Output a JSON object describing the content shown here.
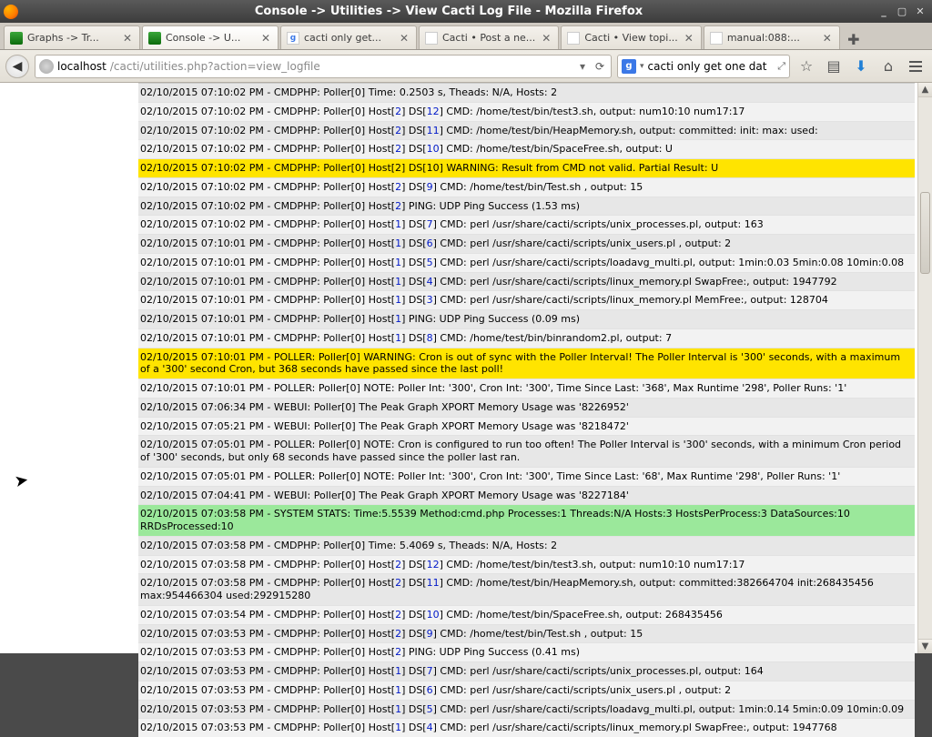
{
  "window": {
    "title": "Console -> Utilities -> View Cacti Log File - Mozilla Firefox"
  },
  "tabs": [
    {
      "label": "Graphs -> Tr...",
      "kind": "cacti"
    },
    {
      "label": "Console -> U...",
      "kind": "cacti",
      "active": true
    },
    {
      "label": "cacti only get...",
      "kind": "google"
    },
    {
      "label": "Cacti • Post a ne...",
      "kind": "plain"
    },
    {
      "label": "Cacti • View topi...",
      "kind": "plain"
    },
    {
      "label": "manual:088:...",
      "kind": "doc"
    }
  ],
  "url": {
    "host": "localhost",
    "path": "/cacti/utilities.php?action=view_logfile"
  },
  "search": {
    "value": "cacti only get one dat"
  },
  "log": [
    {
      "cls": "g2 trim",
      "segs": [
        {
          "t": "02/10/2015 07:10:02 PM - CMDPHP: Poller[0] Time: 0.2503 s, Theads: N/A, Hosts: 2"
        }
      ]
    },
    {
      "cls": "g1",
      "segs": [
        {
          "t": "02/10/2015 07:10:02 PM - CMDPHP: Poller[0] Host["
        },
        {
          "t": "2",
          "b": 1
        },
        {
          "t": "] DS["
        },
        {
          "t": "12",
          "b": 1
        },
        {
          "t": "] CMD: /home/test/bin/test3.sh, output: num10:10 num17:17"
        }
      ]
    },
    {
      "cls": "g2",
      "segs": [
        {
          "t": "02/10/2015 07:10:02 PM - CMDPHP: Poller[0] Host["
        },
        {
          "t": "2",
          "b": 1
        },
        {
          "t": "] DS["
        },
        {
          "t": "11",
          "b": 1
        },
        {
          "t": "] CMD: /home/test/bin/HeapMemory.sh, output: committed: init: max: used:"
        }
      ]
    },
    {
      "cls": "g1",
      "segs": [
        {
          "t": "02/10/2015 07:10:02 PM - CMDPHP: Poller[0] Host["
        },
        {
          "t": "2",
          "b": 1
        },
        {
          "t": "] DS["
        },
        {
          "t": "10",
          "b": 1
        },
        {
          "t": "] CMD: /home/test/bin/SpaceFree.sh, output: U"
        }
      ]
    },
    {
      "cls": "warn",
      "segs": [
        {
          "t": "02/10/2015 07:10:02 PM - CMDPHP: Poller[0] Host[2] DS[10] WARNING: Result from CMD not valid. Partial Result: U"
        }
      ]
    },
    {
      "cls": "g1",
      "segs": [
        {
          "t": "02/10/2015 07:10:02 PM - CMDPHP: Poller[0] Host["
        },
        {
          "t": "2",
          "b": 1
        },
        {
          "t": "] DS["
        },
        {
          "t": "9",
          "b": 1
        },
        {
          "t": "] CMD: /home/test/bin/Test.sh , output: 15"
        }
      ]
    },
    {
      "cls": "g2",
      "segs": [
        {
          "t": "02/10/2015 07:10:02 PM - CMDPHP: Poller[0] Host["
        },
        {
          "t": "2",
          "b": 1
        },
        {
          "t": "] PING: UDP Ping Success (1.53 ms)"
        }
      ]
    },
    {
      "cls": "g1",
      "segs": [
        {
          "t": "02/10/2015 07:10:02 PM - CMDPHP: Poller[0] Host["
        },
        {
          "t": "1",
          "b": 1
        },
        {
          "t": "] DS["
        },
        {
          "t": "7",
          "b": 1
        },
        {
          "t": "] CMD: perl /usr/share/cacti/scripts/unix_processes.pl, output: 163"
        }
      ]
    },
    {
      "cls": "g2",
      "segs": [
        {
          "t": "02/10/2015 07:10:01 PM - CMDPHP: Poller[0] Host["
        },
        {
          "t": "1",
          "b": 1
        },
        {
          "t": "] DS["
        },
        {
          "t": "6",
          "b": 1
        },
        {
          "t": "] CMD: perl /usr/share/cacti/scripts/unix_users.pl , output: 2"
        }
      ]
    },
    {
      "cls": "g1",
      "segs": [
        {
          "t": "02/10/2015 07:10:01 PM - CMDPHP: Poller[0] Host["
        },
        {
          "t": "1",
          "b": 1
        },
        {
          "t": "] DS["
        },
        {
          "t": "5",
          "b": 1
        },
        {
          "t": "] CMD: perl /usr/share/cacti/scripts/loadavg_multi.pl, output: 1min:0.03 5min:0.08 10min:0.08"
        }
      ]
    },
    {
      "cls": "g2",
      "segs": [
        {
          "t": "02/10/2015 07:10:01 PM - CMDPHP: Poller[0] Host["
        },
        {
          "t": "1",
          "b": 1
        },
        {
          "t": "] DS["
        },
        {
          "t": "4",
          "b": 1
        },
        {
          "t": "] CMD: perl /usr/share/cacti/scripts/linux_memory.pl SwapFree:, output: 1947792"
        }
      ]
    },
    {
      "cls": "g1",
      "segs": [
        {
          "t": "02/10/2015 07:10:01 PM - CMDPHP: Poller[0] Host["
        },
        {
          "t": "1",
          "b": 1
        },
        {
          "t": "] DS["
        },
        {
          "t": "3",
          "b": 1
        },
        {
          "t": "] CMD: perl /usr/share/cacti/scripts/linux_memory.pl MemFree:, output: 128704"
        }
      ]
    },
    {
      "cls": "g2",
      "segs": [
        {
          "t": "02/10/2015 07:10:01 PM - CMDPHP: Poller[0] Host["
        },
        {
          "t": "1",
          "b": 1
        },
        {
          "t": "] PING: UDP Ping Success (0.09 ms)"
        }
      ]
    },
    {
      "cls": "g1",
      "segs": [
        {
          "t": "02/10/2015 07:10:01 PM - CMDPHP: Poller[0] Host["
        },
        {
          "t": "1",
          "b": 1
        },
        {
          "t": "] DS["
        },
        {
          "t": "8",
          "b": 1
        },
        {
          "t": "] CMD: /home/test/bin/binrandom2.pl, output: 7"
        }
      ]
    },
    {
      "cls": "warn",
      "segs": [
        {
          "t": "02/10/2015 07:10:01 PM - POLLER: Poller[0] WARNING: Cron is out of sync with the Poller Interval! The Poller Interval is '300' seconds, with a maximum of a '300' second Cron, but 368 seconds have passed since the last poll!"
        }
      ]
    },
    {
      "cls": "g1",
      "segs": [
        {
          "t": "02/10/2015 07:10:01 PM - POLLER: Poller[0] NOTE: Poller Int: '300', Cron Int: '300', Time Since Last: '368', Max Runtime '298', Poller Runs: '1'"
        }
      ]
    },
    {
      "cls": "g2",
      "segs": [
        {
          "t": "02/10/2015 07:06:34 PM - WEBUI: Poller[0] The Peak Graph XPORT Memory Usage was '8226952'"
        }
      ]
    },
    {
      "cls": "g1",
      "segs": [
        {
          "t": "02/10/2015 07:05:21 PM - WEBUI: Poller[0] The Peak Graph XPORT Memory Usage was '8218472'"
        }
      ]
    },
    {
      "cls": "g2",
      "segs": [
        {
          "t": "02/10/2015 07:05:01 PM - POLLER: Poller[0] NOTE: Cron is configured to run too often! The Poller Interval is '300' seconds, with a minimum Cron period of '300' seconds, but only 68 seconds have passed since the poller last ran."
        }
      ]
    },
    {
      "cls": "g1",
      "segs": [
        {
          "t": "02/10/2015 07:05:01 PM - POLLER: Poller[0] NOTE: Poller Int: '300', Cron Int: '300', Time Since Last: '68', Max Runtime '298', Poller Runs: '1'"
        }
      ]
    },
    {
      "cls": "g2",
      "segs": [
        {
          "t": "02/10/2015 07:04:41 PM - WEBUI: Poller[0] The Peak Graph XPORT Memory Usage was '8227184'"
        }
      ]
    },
    {
      "cls": "ok",
      "segs": [
        {
          "t": "02/10/2015 07:03:58 PM - SYSTEM STATS: Time:5.5539 Method:cmd.php Processes:1 Threads:N/A Hosts:3 HostsPerProcess:3 DataSources:10 RRDsProcessed:10"
        }
      ]
    },
    {
      "cls": "g2",
      "segs": [
        {
          "t": "02/10/2015 07:03:58 PM - CMDPHP: Poller[0] Time: 5.4069 s, Theads: N/A, Hosts: 2"
        }
      ]
    },
    {
      "cls": "g1",
      "segs": [
        {
          "t": "02/10/2015 07:03:58 PM - CMDPHP: Poller[0] Host["
        },
        {
          "t": "2",
          "b": 1
        },
        {
          "t": "] DS["
        },
        {
          "t": "12",
          "b": 1
        },
        {
          "t": "] CMD: /home/test/bin/test3.sh, output: num10:10 num17:17"
        }
      ]
    },
    {
      "cls": "g2",
      "segs": [
        {
          "t": "02/10/2015 07:03:58 PM - CMDPHP: Poller[0] Host["
        },
        {
          "t": "2",
          "b": 1
        },
        {
          "t": "] DS["
        },
        {
          "t": "11",
          "b": 1
        },
        {
          "t": "] CMD: /home/test/bin/HeapMemory.sh, output: committed:382664704 init:268435456 max:954466304 used:292915280"
        }
      ]
    },
    {
      "cls": "g1",
      "segs": [
        {
          "t": "02/10/2015 07:03:54 PM - CMDPHP: Poller[0] Host["
        },
        {
          "t": "2",
          "b": 1
        },
        {
          "t": "] DS["
        },
        {
          "t": "10",
          "b": 1
        },
        {
          "t": "] CMD: /home/test/bin/SpaceFree.sh, output: 268435456"
        }
      ]
    },
    {
      "cls": "g2",
      "segs": [
        {
          "t": "02/10/2015 07:03:53 PM - CMDPHP: Poller[0] Host["
        },
        {
          "t": "2",
          "b": 1
        },
        {
          "t": "] DS["
        },
        {
          "t": "9",
          "b": 1
        },
        {
          "t": "] CMD: /home/test/bin/Test.sh , output: 15"
        }
      ]
    },
    {
      "cls": "g1",
      "segs": [
        {
          "t": "02/10/2015 07:03:53 PM - CMDPHP: Poller[0] Host["
        },
        {
          "t": "2",
          "b": 1
        },
        {
          "t": "] PING: UDP Ping Success (0.41 ms)"
        }
      ]
    },
    {
      "cls": "g2",
      "segs": [
        {
          "t": "02/10/2015 07:03:53 PM - CMDPHP: Poller[0] Host["
        },
        {
          "t": "1",
          "b": 1
        },
        {
          "t": "] DS["
        },
        {
          "t": "7",
          "b": 1
        },
        {
          "t": "] CMD: perl /usr/share/cacti/scripts/unix_processes.pl, output: 164"
        }
      ]
    },
    {
      "cls": "g1",
      "segs": [
        {
          "t": "02/10/2015 07:03:53 PM - CMDPHP: Poller[0] Host["
        },
        {
          "t": "1",
          "b": 1
        },
        {
          "t": "] DS["
        },
        {
          "t": "6",
          "b": 1
        },
        {
          "t": "] CMD: perl /usr/share/cacti/scripts/unix_users.pl , output: 2"
        }
      ]
    },
    {
      "cls": "g2",
      "segs": [
        {
          "t": "02/10/2015 07:03:53 PM - CMDPHP: Poller[0] Host["
        },
        {
          "t": "1",
          "b": 1
        },
        {
          "t": "] DS["
        },
        {
          "t": "5",
          "b": 1
        },
        {
          "t": "] CMD: perl /usr/share/cacti/scripts/loadavg_multi.pl, output: 1min:0.14 5min:0.09 10min:0.09"
        }
      ]
    },
    {
      "cls": "g1",
      "segs": [
        {
          "t": "02/10/2015 07:03:53 PM - CMDPHP: Poller[0] Host["
        },
        {
          "t": "1",
          "b": 1
        },
        {
          "t": "] DS["
        },
        {
          "t": "4",
          "b": 1
        },
        {
          "t": "] CMD: perl /usr/share/cacti/scripts/linux_memory.pl SwapFree:, output: 1947768"
        }
      ]
    }
  ]
}
